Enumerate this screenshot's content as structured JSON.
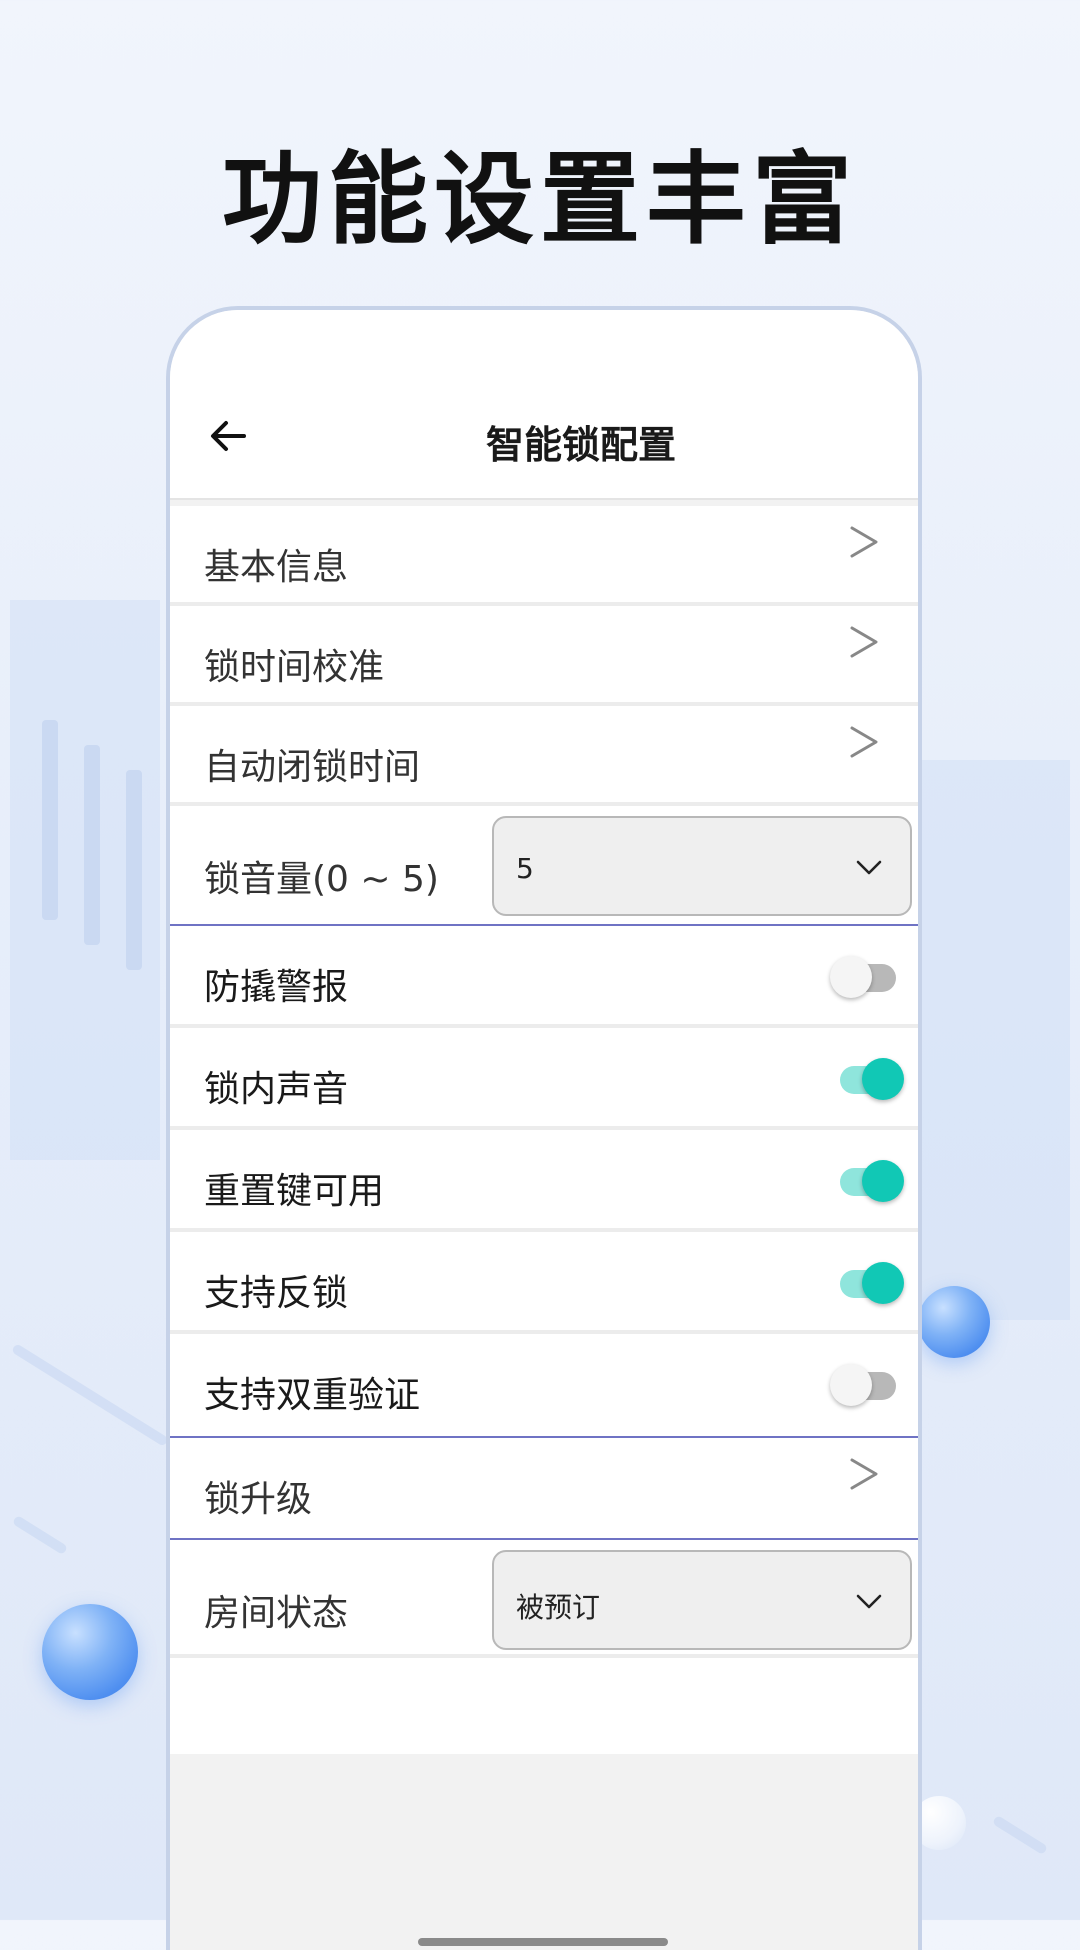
{
  "headline": "功能设置丰富",
  "screen": {
    "title": "智能锁配置"
  },
  "menu": {
    "basic_info": "基本信息",
    "lock_time_calibration": "锁时间校准",
    "auto_lock_time": "自动闭锁时间",
    "volume_label": "锁音量(0 ~ 5)",
    "volume_value": "5",
    "lock_upgrade": "锁升级",
    "room_status_label": "房间状态",
    "room_status_value": "被预订"
  },
  "toggles": [
    {
      "label": "防撬警报",
      "on": false
    },
    {
      "label": "锁内声音",
      "on": true
    },
    {
      "label": "重置键可用",
      "on": true
    },
    {
      "label": "支持反锁",
      "on": true
    },
    {
      "label": "支持双重验证",
      "on": false
    }
  ],
  "colors": {
    "accent": "#11c8b5",
    "accent_track": "#8fe5dc",
    "divider": "#6f73c4"
  },
  "icons": {
    "back": "arrow-left-icon",
    "nav": "chevron-right-icon",
    "dropdown": "chevron-down-icon"
  }
}
